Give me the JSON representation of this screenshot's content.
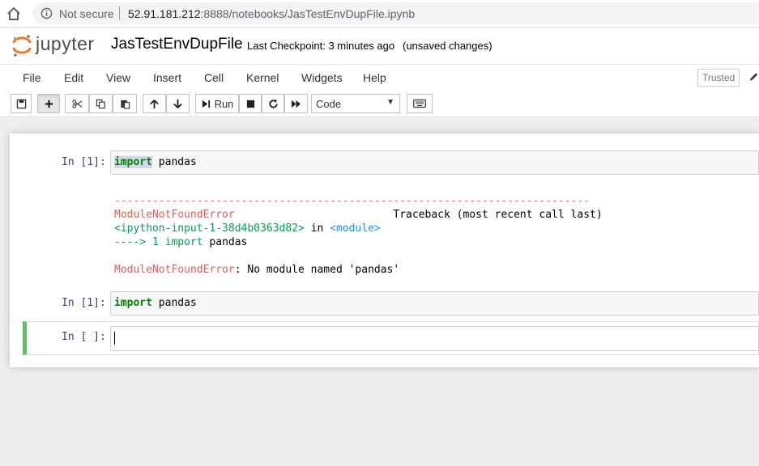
{
  "browser": {
    "security_label": "Not secure",
    "url_host": "52.91.181.212",
    "url_rest": ":8888/notebooks/JasTestEnvDupFile.ipynb"
  },
  "header": {
    "logo_text": "jupyter",
    "notebook_name": "JasTestEnvDupFile",
    "checkpoint": "Last Checkpoint: 3 minutes ago",
    "status": "(unsaved changes)"
  },
  "menu": {
    "items": [
      "File",
      "Edit",
      "View",
      "Insert",
      "Cell",
      "Kernel",
      "Widgets",
      "Help"
    ],
    "trusted": "Trusted"
  },
  "toolbar": {
    "run_label": "Run",
    "cell_type": "Code"
  },
  "cells": {
    "c1": {
      "prompt": "In [1]:",
      "code_kw": "import",
      "code_rest": " pandas",
      "output": {
        "dashes": "---------------------------------------------------------------------------",
        "error_name": "ModuleNotFoundError",
        "traceback_label": "Traceback (most recent call last)",
        "input_ref": "<ipython-input-1-38d4b0363d82>",
        "in_word": " in ",
        "module_ref": "<module>",
        "arrow": "----> 1 ",
        "arrow_kw": "import",
        "arrow_rest": " pandas",
        "error_msg": ": No module named 'pandas'"
      }
    },
    "c2": {
      "prompt": "In [1]:",
      "code_kw": "import",
      "code_rest": " pandas"
    },
    "c3": {
      "prompt": "In [ ]:"
    }
  }
}
